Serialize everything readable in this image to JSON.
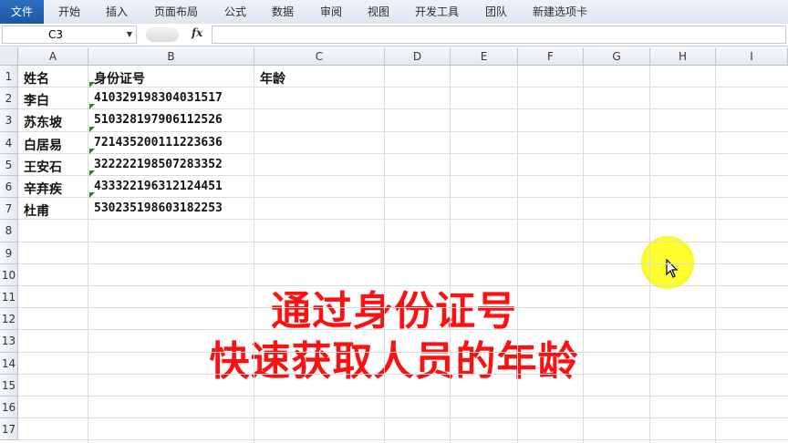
{
  "ribbon": {
    "file_tab": "文件",
    "tabs": [
      "开始",
      "插入",
      "页面布局",
      "公式",
      "数据",
      "审阅",
      "视图",
      "开发工具",
      "团队",
      "新建选项卡"
    ]
  },
  "formula_bar": {
    "name_box": "C3",
    "fx_label": "fx",
    "formula": ""
  },
  "sheet": {
    "columns": [
      "A",
      "B",
      "C",
      "D",
      "E",
      "F",
      "G",
      "H",
      "I"
    ],
    "rows": [
      "1",
      "2",
      "3",
      "4",
      "5",
      "6",
      "7",
      "8",
      "9",
      "10",
      "11",
      "12",
      "13",
      "14",
      "15",
      "16",
      "17"
    ],
    "header_row": {
      "name": "姓名",
      "id": "身份证号",
      "age": "年龄"
    },
    "records": [
      {
        "name": "李白",
        "id": "410329198304031517"
      },
      {
        "name": "苏东坡",
        "id": "510328197906112526"
      },
      {
        "name": "白居易",
        "id": "721435200111223636"
      },
      {
        "name": "王安石",
        "id": "322222198507283352"
      },
      {
        "name": "辛弃疾",
        "id": "433322196312124451"
      },
      {
        "name": "杜甫",
        "id": "530235198603182253"
      }
    ]
  },
  "overlay": {
    "line1": "通过身份证号",
    "line2": "快速获取人员的年龄",
    "color": "#ff1010"
  },
  "colors": {
    "file_tab": "#1d57a6",
    "error_indicator": "#1e8a2e",
    "cursor_highlight": "#ffff30"
  }
}
